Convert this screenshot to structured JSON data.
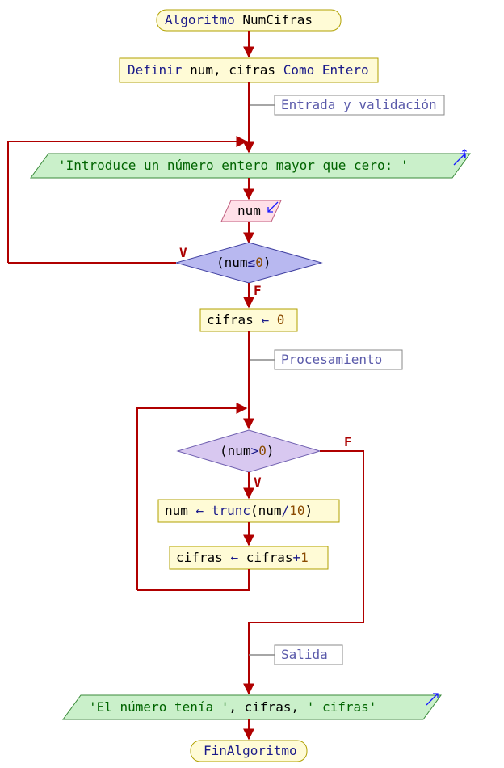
{
  "title_kw": "Algoritmo",
  "title_name": "NumCifras",
  "define_kw": "Definir",
  "define_vars": "num, cifras",
  "define_como_kw": "Como Entero",
  "section_input": "Entrada y validación",
  "prompt_str": "'Introduce un número entero mayor que cero: '",
  "read_var": "num",
  "cond1_open": "(",
  "cond1_var": "num",
  "cond1_op": "≤",
  "cond1_num": "0",
  "cond1_close": ")",
  "true_label": "V",
  "false_label": "F",
  "assign1_var": "cifras",
  "assign1_arrow": "←",
  "assign1_val": "0",
  "section_proc": "Procesamiento",
  "cond2_open": "(",
  "cond2_var": "num",
  "cond2_op": ">",
  "cond2_num": "0",
  "cond2_close": ")",
  "assign2_var": "num",
  "assign2_arrow": "←",
  "assign2_fn": "trunc",
  "assign2_inner_var": "num",
  "assign2_div": "/",
  "assign2_ten": "10",
  "assign3_var": "cifras",
  "assign3_arrow": "←",
  "assign3_rhs": "cifras",
  "assign3_plus": "+",
  "assign3_one": "1",
  "section_out": "Salida",
  "out_str1": "'El número tenía '",
  "out_var": "cifras",
  "out_str2": "' cifras'",
  "end_kw": "FinAlgoritmo"
}
